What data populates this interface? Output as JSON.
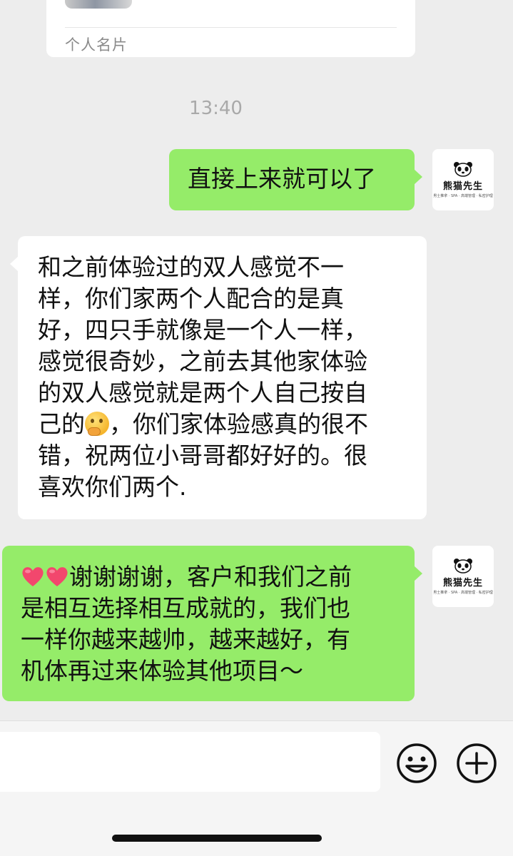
{
  "card": {
    "label": "个人名片"
  },
  "timestamp": "13:40",
  "brand": {
    "name": "熊猫先生",
    "sub": "男士推拿 · SPA · 高端管理 · 私密护理"
  },
  "messages": {
    "m1": {
      "side": "right",
      "text": "直接上来就可以了"
    },
    "m2": {
      "side": "left",
      "lines": [
        "和之前体验过的双人感觉不一",
        "样，你们家两个人配合的是真",
        "好，四只手就像是一个人一样，",
        "感觉很奇妙，之前去其他家体验",
        "的双人感觉就是两个人自己按自",
        "，你们家体验感真的很不",
        "错，祝两位小哥哥都好好的。很",
        "喜欢你们两个."
      ],
      "line6_prefix": "己的",
      "emoji": "thinking-face"
    },
    "m3": {
      "side": "right",
      "lines": [
        "谢谢谢谢，客户和我们之前",
        "是相互选择相互成就的，我们也",
        "一样你越来越帅，越来越好，有",
        "机体再过来体验其他项目～"
      ],
      "emoji": "two-hearts"
    }
  },
  "icons": {
    "emoji_button": "smiley-icon",
    "more_button": "plus-circle-icon"
  },
  "colors": {
    "background": "#ededed",
    "self_bubble": "#95ec69",
    "other_bubble": "#ffffff",
    "heart": "#f2476d"
  }
}
